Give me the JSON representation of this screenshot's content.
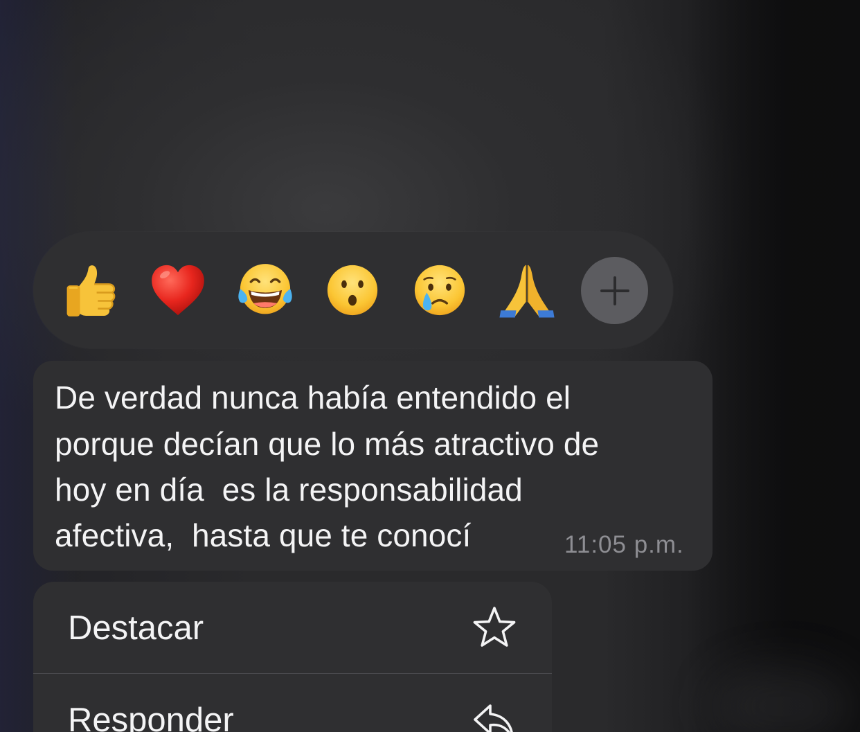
{
  "reactions": [
    {
      "icon": "thumbs-up-emoji",
      "label": "👍"
    },
    {
      "icon": "red-heart-emoji",
      "label": "❤️"
    },
    {
      "icon": "face-with-tears-of-joy-emoji",
      "label": "😂"
    },
    {
      "icon": "face-with-open-mouth-emoji",
      "label": "😮"
    },
    {
      "icon": "crying-face-emoji",
      "label": "😢"
    },
    {
      "icon": "folded-hands-emoji",
      "label": "🙏"
    }
  ],
  "add_reaction": {
    "icon": "plus-icon"
  },
  "message": {
    "lines": [
      "De verdad nunca había entendido el",
      "porque decían que lo más atractivo de",
      "hoy en día  es la responsabilidad",
      "afectiva,  hasta que te conocí"
    ],
    "time": "11:05 p.m."
  },
  "menu": {
    "items": [
      {
        "label": "Destacar",
        "icon": "star-icon"
      },
      {
        "label": "Responder",
        "icon": "reply-icon"
      }
    ]
  },
  "colors": {
    "bubble": "#2f2f31",
    "text": "#f4f4f5",
    "time": "#8e8e93",
    "add_button": "#5c5c60"
  }
}
